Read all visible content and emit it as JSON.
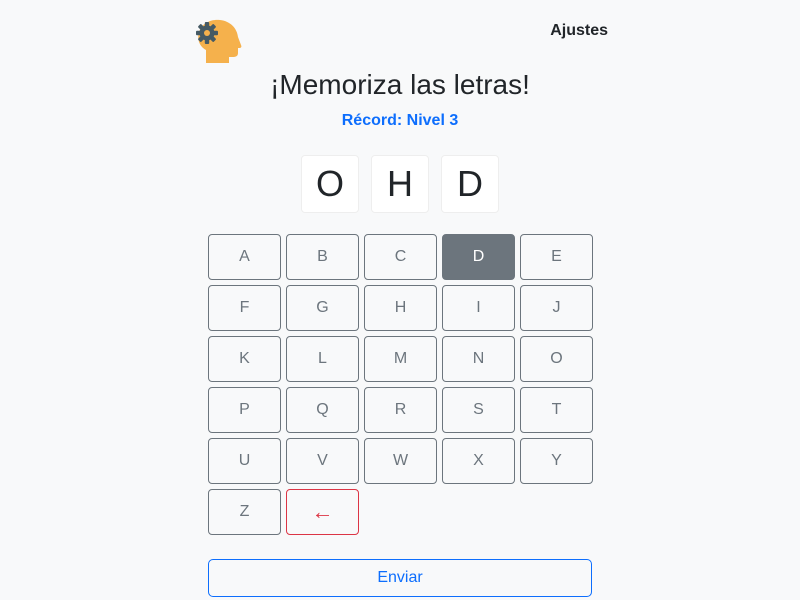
{
  "header": {
    "logo_icon": "brain-gear-icon",
    "settings_label": "Ajustes"
  },
  "title": "¡Memoriza las letras!",
  "record": "Récord: Nivel 3",
  "sequence": [
    "O",
    "H",
    "D"
  ],
  "keyboard": {
    "keys": [
      "A",
      "B",
      "C",
      "D",
      "E",
      "F",
      "G",
      "H",
      "I",
      "J",
      "K",
      "L",
      "M",
      "N",
      "O",
      "P",
      "Q",
      "R",
      "S",
      "T",
      "U",
      "V",
      "W",
      "X",
      "Y",
      "Z"
    ],
    "active_key": "D",
    "backspace_label": "←"
  },
  "submit_label": "Enviar",
  "colors": {
    "accent": "#0d6efd",
    "secondary": "#6c757d",
    "danger": "#dc3545",
    "logo_head": "#f5b14c",
    "logo_gear": "#455a64"
  }
}
